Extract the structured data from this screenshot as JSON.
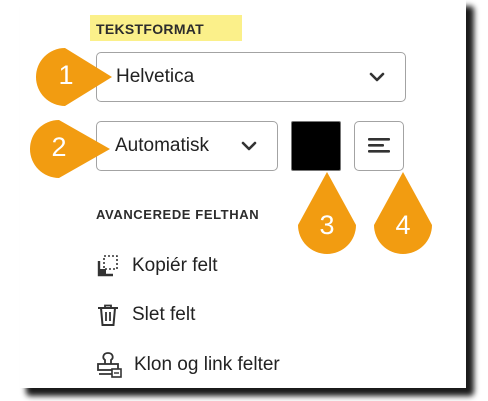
{
  "section_title": "TEKSTFORMAT",
  "font_dropdown": {
    "value": "Helvetica",
    "icon": "chevron-down-icon"
  },
  "size_dropdown": {
    "value": "Automatisk",
    "icon": "chevron-down-icon"
  },
  "text_color": {
    "value": "#000000"
  },
  "alignment_button": {
    "icon": "align-left-icon"
  },
  "advanced_title": "AVANCEREDE FELTHAN",
  "actions": [
    {
      "label": "Kopiér felt",
      "icon": "copy-field-icon"
    },
    {
      "label": "Slet felt",
      "icon": "trash-icon"
    },
    {
      "label": "Klon og link felter",
      "icon": "stamp-icon"
    }
  ],
  "callouts": [
    "1",
    "2",
    "3",
    "4"
  ],
  "callout_color": "#f29c11"
}
